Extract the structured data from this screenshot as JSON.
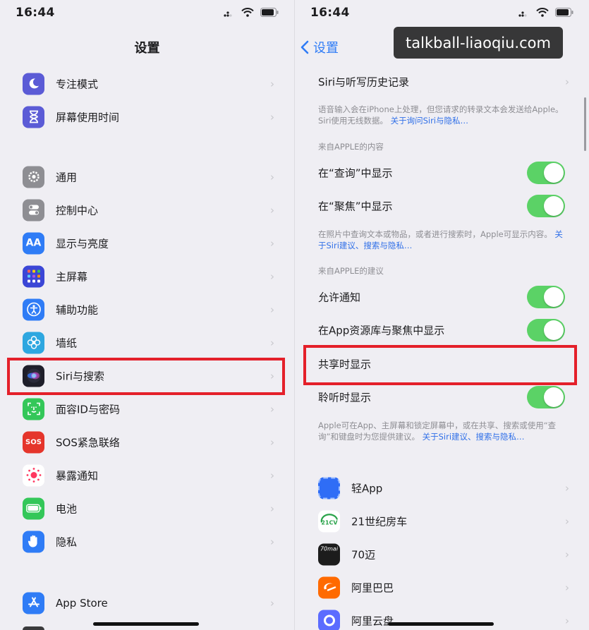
{
  "status_bar": {
    "left_time": "16:44",
    "right_time": "16:44"
  },
  "left_panel": {
    "title": "设置",
    "items": [
      {
        "label": "专注模式",
        "icon": "moon-icon",
        "color": "#5b5bd6"
      },
      {
        "label": "屏幕使用时间",
        "icon": "hourglass-icon",
        "color": "#5b5bd6"
      },
      {
        "label": "通用",
        "icon": "gear-icon",
        "color": "#8e8e93"
      },
      {
        "label": "控制中心",
        "icon": "toggles-icon",
        "color": "#8e8e93"
      },
      {
        "label": "显示与亮度",
        "icon": "text-size-icon",
        "color": "#2f7cf6"
      },
      {
        "label": "主屏幕",
        "icon": "app-grid-icon",
        "color": "#3b46d6"
      },
      {
        "label": "辅助功能",
        "icon": "accessibility-icon",
        "color": "#2f7cf6"
      },
      {
        "label": "墙纸",
        "icon": "flower-icon",
        "color": "#2ea7e0"
      },
      {
        "label": "Siri与搜索",
        "icon": "siri-icon",
        "color": "#1e1e2a"
      },
      {
        "label": "面容ID与密码",
        "icon": "face-id-icon",
        "color": "#34c759"
      },
      {
        "label": "SOS紧急联络",
        "icon": "sos-icon",
        "color": "#e5352b",
        "icon_text": "SOS"
      },
      {
        "label": "暴露通知",
        "icon": "exposure-icon",
        "color": "#ffffff"
      },
      {
        "label": "电池",
        "icon": "battery-icon",
        "color": "#34c759"
      },
      {
        "label": "隐私",
        "icon": "hand-icon",
        "color": "#2f7cf6"
      },
      {
        "label": "App Store",
        "icon": "app-store-icon",
        "color": "#2f7cf6"
      }
    ]
  },
  "right_panel": {
    "back_label": "设置",
    "history_label": "Siri与听写历史记录",
    "note1": "语音输入会在iPhone上处理，但您请求的转录文本会发送给Apple。Siri使用无线数据。",
    "note1_link": "关于询问Siri与隐私…",
    "section1": "来自APPLE的内容",
    "show_in_lookup": "在“查询”中显示",
    "show_in_spotlight": "在“聚焦”中显示",
    "note2": "在照片中查询文本或物品，或者进行搜索时，Apple可显示内容。",
    "note2_link": "关于Siri建议、搜索与隐私…",
    "section2": "来自APPLE的建议",
    "allow_notifications": "允许通知",
    "show_in_app_library": "在App资源库与聚焦中显示",
    "show_when_sharing": "共享时显示",
    "show_when_listening": "聆听时显示",
    "note3": "Apple可在App、主屏幕和锁定屏幕中，或在共享、搜索或使用“查询”和键盘时为您提供建议。",
    "note3_link": "关于Siri建议、搜索与隐私…",
    "apps": [
      {
        "label": "轻App",
        "icon": "qing-app-icon",
        "color": "#2f6df6"
      },
      {
        "label": "21世纪房车",
        "icon": "rv21-icon",
        "color": "#ffffff"
      },
      {
        "label": "70迈",
        "icon": "70mai-icon",
        "color": "#1c1c1c",
        "icon_text": "70mai"
      },
      {
        "label": "阿里巴巴",
        "icon": "alibaba-icon",
        "color": "#ff6a00"
      },
      {
        "label": "阿里云盘",
        "icon": "aliyun-drive-icon",
        "color": "#5b6cff"
      }
    ]
  },
  "watermark": "talkball-liaoqiu.com",
  "colors": {
    "toggle_on": "#5bd266",
    "link": "#2f6fe8",
    "highlight": "#e4202a"
  }
}
